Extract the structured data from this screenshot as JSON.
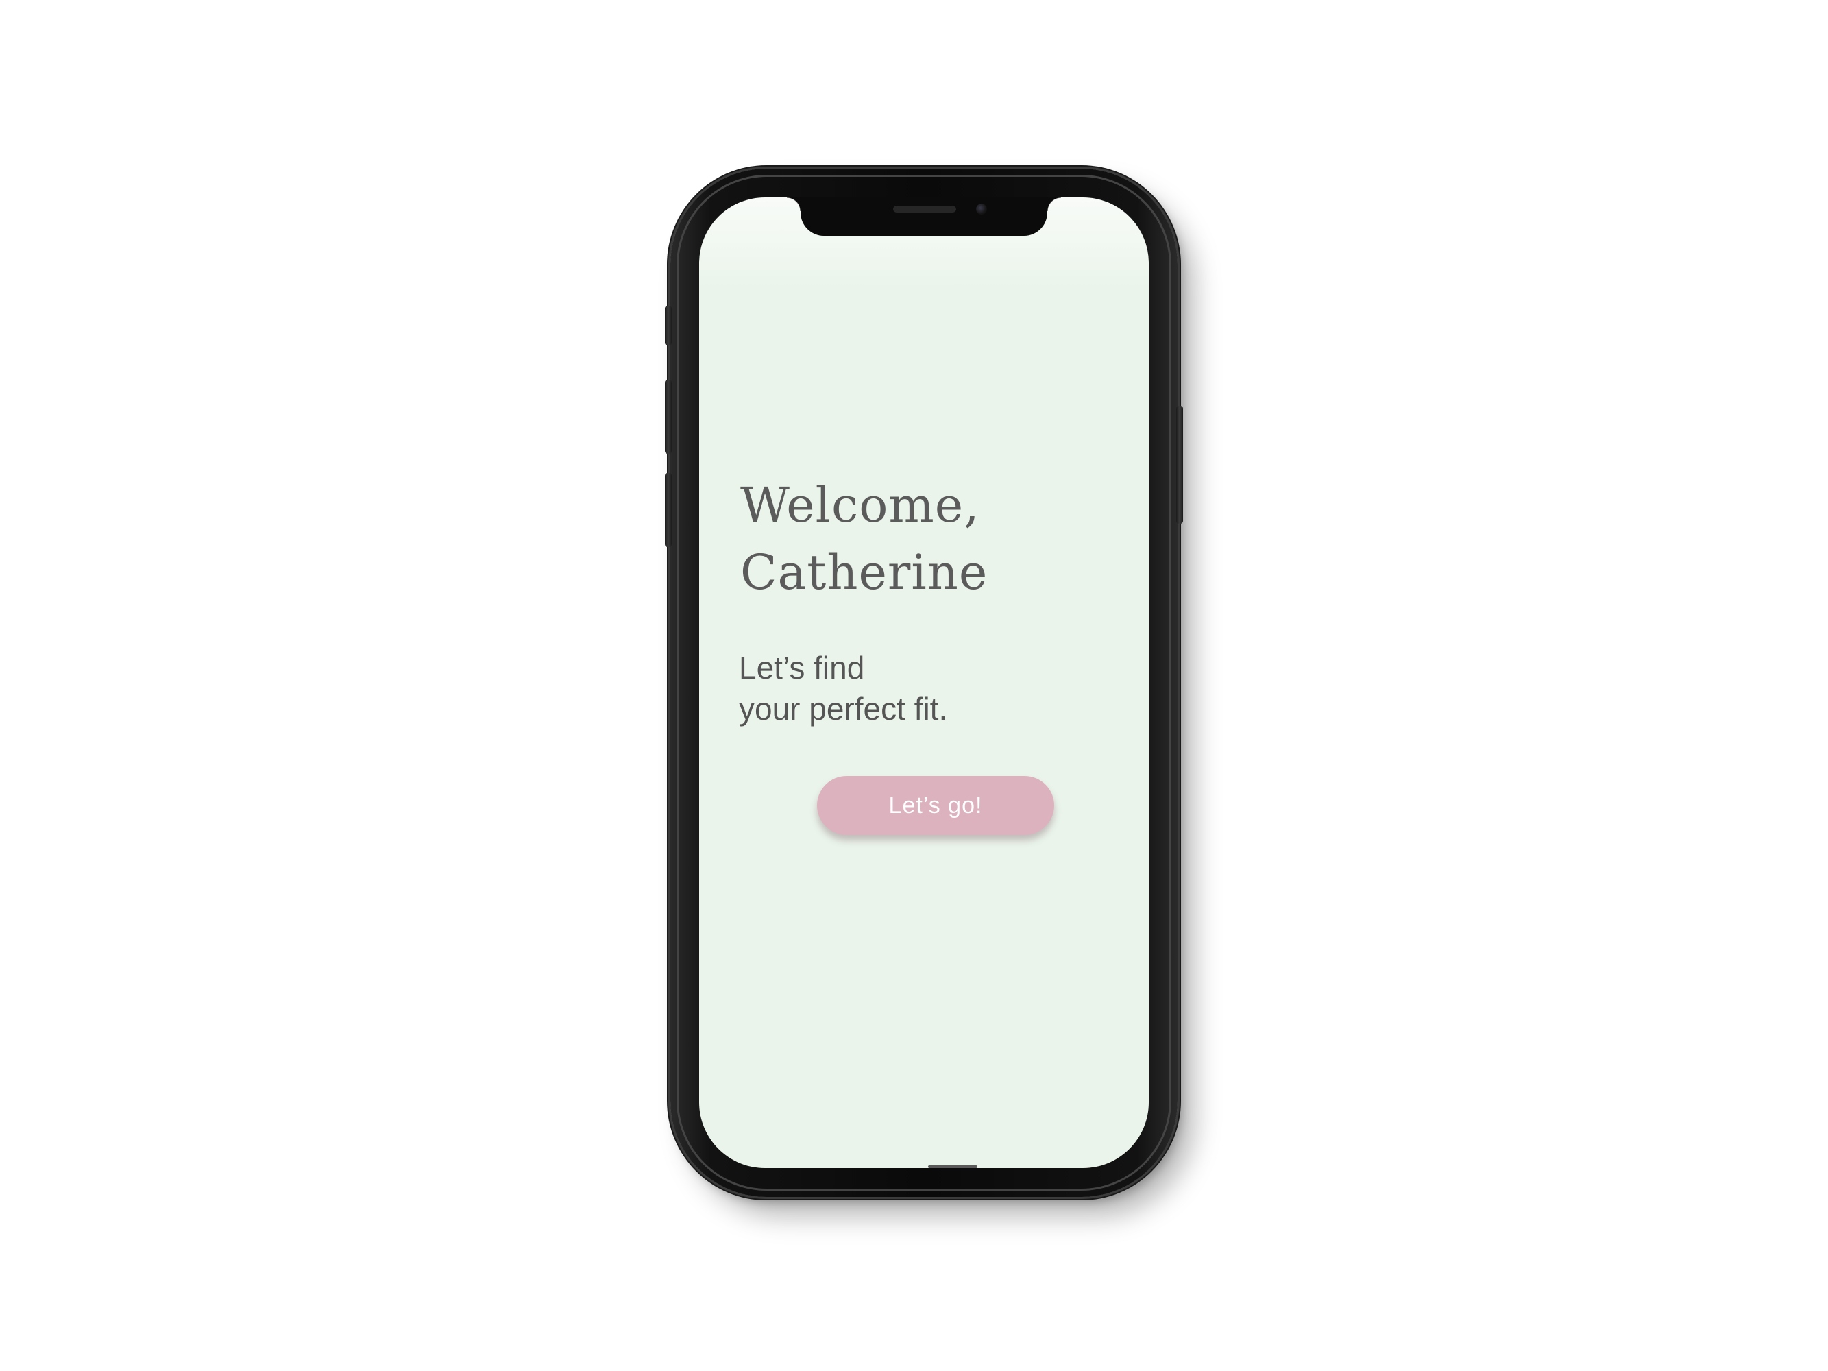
{
  "screen": {
    "welcome_line1": "Welcome,",
    "welcome_line2": "Catherine",
    "tagline_line1": "Let’s find",
    "tagline_line2": "your perfect fit.",
    "cta_label": "Let’s go!"
  },
  "colors": {
    "screen_background": "#eaf4ea",
    "heading_text": "#5b5b5b",
    "button_background": "#dcb2bf",
    "button_text": "#ffffff",
    "phone_frame": "#111111"
  },
  "icons": {
    "front_camera": "camera-icon",
    "earpiece": "speaker-icon"
  }
}
